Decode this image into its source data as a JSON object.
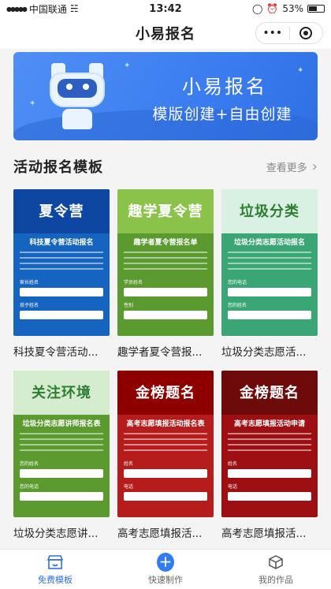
{
  "status_bar": {
    "carrier": "中国联通",
    "time": "13:42",
    "battery": "53%"
  },
  "nav": {
    "title": "小易报名",
    "more_icon": "dots-icon",
    "close_icon": "target-icon"
  },
  "banner": {
    "title": "小易报名",
    "subtitle": "模版创建+自由创建"
  },
  "section": {
    "title": "活动报名模板",
    "see_more": "查看更多"
  },
  "templates": [
    {
      "name": "科技夏令营活动...",
      "header": "夏令营",
      "form_title": "科技夏令营活动报名",
      "field1": "家长姓名",
      "field2": "孩子姓名",
      "colors": {
        "bg": "#1565c0",
        "hdr": "#0d47a1"
      }
    },
    {
      "name": "趣学者夏令营报...",
      "header": "趣学夏令营",
      "form_title": "趣学者夏令营报名单",
      "field1": "学员姓名",
      "field2": "性别",
      "colors": {
        "bg": "#5b9a2e",
        "hdr": "#8bc34a"
      }
    },
    {
      "name": "垃圾分类志愿活...",
      "header": "垃圾分类",
      "form_title": "垃圾分类志愿活动报名",
      "field1": "您的电话",
      "field2": "您的姓名",
      "colors": {
        "bg": "#3aa675",
        "hdr": "#d8f1e3"
      }
    },
    {
      "name": "垃圾分类志愿讲...",
      "header": "关注环境",
      "form_title": "垃圾分类志愿讲师报名表",
      "field1": "您的姓名",
      "field2": "您的电话",
      "colors": {
        "bg": "#5b9a2e",
        "hdr": "#d6eccf"
      }
    },
    {
      "name": "高考志愿填报活...",
      "header": "金榜题名",
      "form_title": "高考志愿填报活动报名表",
      "field1": "姓名",
      "field2": "电话",
      "colors": {
        "bg": "#b71c1c",
        "hdr": "#8e0000"
      }
    },
    {
      "name": "高考志愿填报活...",
      "header": "金榜题名",
      "form_title": "高考志愿填报活动申请",
      "field1": "姓名",
      "field2": "电话",
      "colors": {
        "bg": "#9e0f14",
        "hdr": "#6d0a0a"
      }
    }
  ],
  "tabbar": {
    "items": [
      {
        "label": "免费模板",
        "icon": "store-icon"
      },
      {
        "label": "快速制作",
        "icon": "plus-icon"
      },
      {
        "label": "我的作品",
        "icon": "box-icon"
      }
    ]
  },
  "accent": "#2f6fe4"
}
